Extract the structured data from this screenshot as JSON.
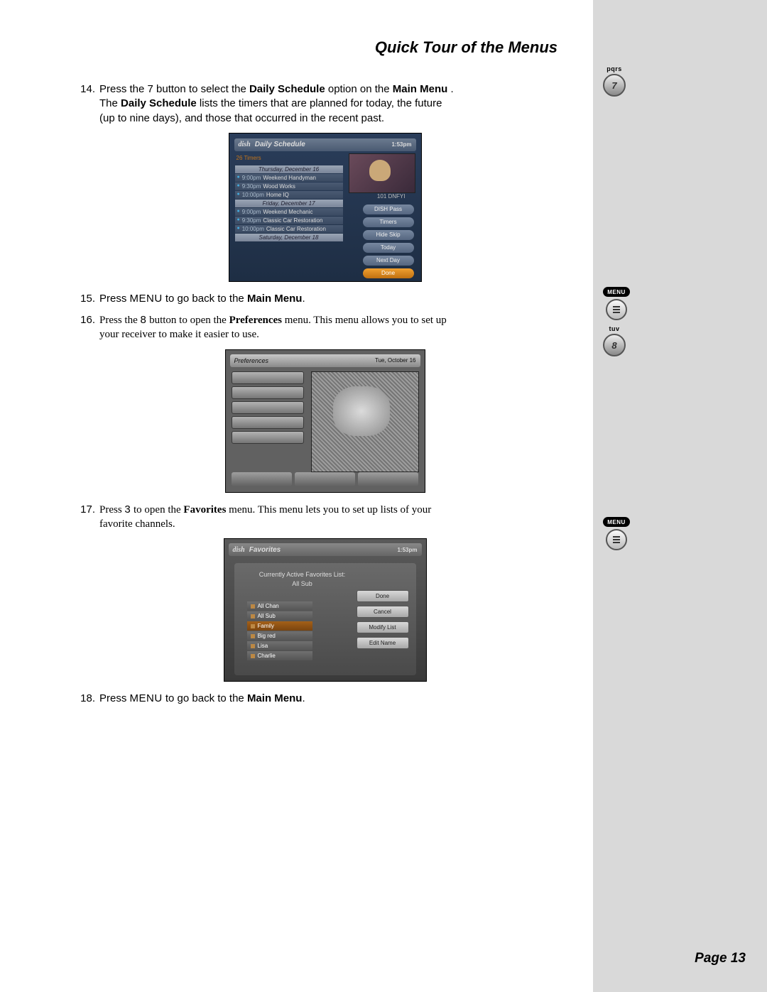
{
  "header": "Quick Tour of the Menus",
  "footer": "Page 13",
  "steps": [
    {
      "num": "14.",
      "p1": "Press the 7 button to select the ",
      "b1": "Daily Schedule",
      "p2": " option on the ",
      "b2": "Main Menu",
      "p3": ". The ",
      "b3": "Daily Schedule",
      "p4": " lists the timers that are planned for today, the future (up to nine days), and those that occurred in the recent past."
    },
    {
      "num": "15.",
      "p1": "Press ",
      "k1": "MENU",
      "p2": " to go back to the ",
      "b1": "Main Menu",
      "p3": "."
    },
    {
      "num": "16.",
      "p1": "Press the ",
      "k1": "8",
      "p2": " button to open the ",
      "b1": "Preferences",
      "p3": " menu. This menu allows you to set up your receiver to make it easier to use."
    },
    {
      "num": "17.",
      "p1": "Press ",
      "k1": "3",
      "p2": " to open the ",
      "b1": "Favorites",
      "p3": " menu. This menu lets you to set up lists of your favorite channels."
    },
    {
      "num": "18.",
      "p1": "Press ",
      "k1": "MENU",
      "p2": " to go back to the ",
      "b1": "Main Menu",
      "p3": "."
    }
  ],
  "icons": [
    {
      "label": "pqrs",
      "key": "7"
    },
    {
      "label": "MENU"
    },
    {
      "label": "tuv",
      "key": "8"
    },
    {
      "label": "MENU"
    }
  ],
  "shot1": {
    "brand": "dish",
    "title": "Daily Schedule",
    "time": "1:53pm",
    "count": "26 Timers",
    "channel": "101 DNFYI",
    "days": [
      "Thursday, December 16",
      "Friday, December 17",
      "Saturday, December 18"
    ],
    "rows": [
      {
        "t": "9:00pm",
        "n": "Weekend Handyman"
      },
      {
        "t": "9:30pm",
        "n": "Wood Works"
      },
      {
        "t": "10:00pm",
        "n": "Home IQ"
      },
      {
        "t": "9:00pm",
        "n": "Weekend Mechanic"
      },
      {
        "t": "9:30pm",
        "n": "Classic Car Restoration"
      },
      {
        "t": "10:00pm",
        "n": "Classic Car Restoration"
      }
    ],
    "btns": [
      "DISH Pass",
      "Timers",
      "Hide Skip",
      "Today",
      "Next Day",
      "Done"
    ]
  },
  "shot2": {
    "title": "Preferences",
    "time": "Tue, October 16"
  },
  "shot3": {
    "brand": "dish",
    "title": "Favorites",
    "time": "1:53pm",
    "active_label": "Currently Active Favorites List:",
    "active_value": "All Sub",
    "lists": [
      "All Chan",
      "All Sub",
      "Family",
      "Big red",
      "Lisa",
      "Charlie"
    ],
    "btns": [
      "Done",
      "Cancel",
      "Modify List",
      "Edit Name"
    ]
  }
}
